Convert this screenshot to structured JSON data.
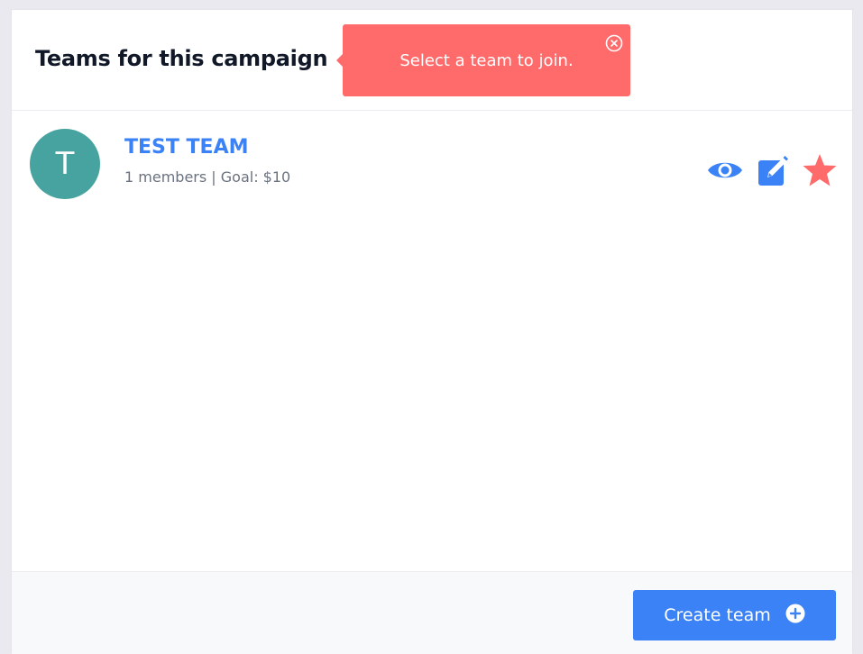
{
  "header": {
    "title": "Teams for this campaign"
  },
  "toast": {
    "message": "Select a team to join.",
    "close_icon": "close-circle-icon",
    "color": "#ff6b6b"
  },
  "teams": [
    {
      "avatar_letter": "T",
      "avatar_color": "#47a39f",
      "name": "TEST TEAM",
      "meta": "1 members | Goal: $10",
      "actions": [
        {
          "icon": "eye-icon",
          "color": "#3b82f6"
        },
        {
          "icon": "edit-icon",
          "color": "#3b82f6"
        },
        {
          "icon": "star-icon",
          "color": "#ff6b6b"
        }
      ]
    }
  ],
  "footer": {
    "create_button_label": "Create team",
    "create_button_icon": "plus-circle-icon",
    "accent": "#3b82f6"
  }
}
